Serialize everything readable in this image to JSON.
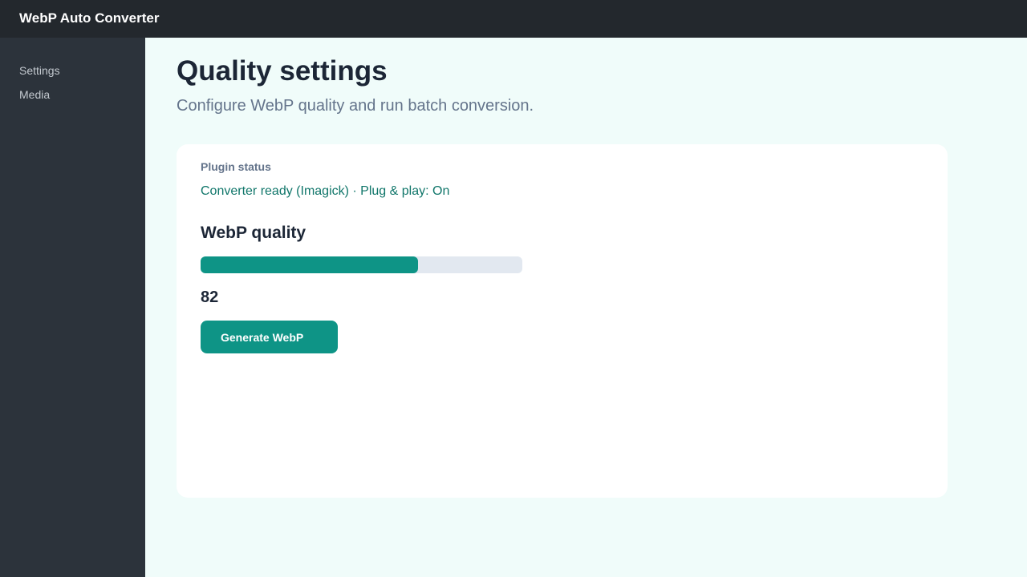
{
  "app": {
    "title": "WebP Auto Converter"
  },
  "sidebar": {
    "items": [
      {
        "label": "Settings"
      },
      {
        "label": "Media"
      }
    ]
  },
  "main": {
    "title": "Quality settings",
    "subtitle": "Configure WebP quality and run batch conversion."
  },
  "card": {
    "status_label": "Plugin status",
    "status_text": "Converter ready (Imagick) · Plug & play: On",
    "quality_title": "WebP quality",
    "quality_value": "82",
    "quality_fill_fraction": 0.675,
    "generate_label": "Generate WebP"
  },
  "colors": {
    "accent": "#0e9486",
    "status_text": "#10766a",
    "topbar": "#23282d",
    "sidebar": "#2c333b",
    "main_bg": "#f0fcfa"
  }
}
